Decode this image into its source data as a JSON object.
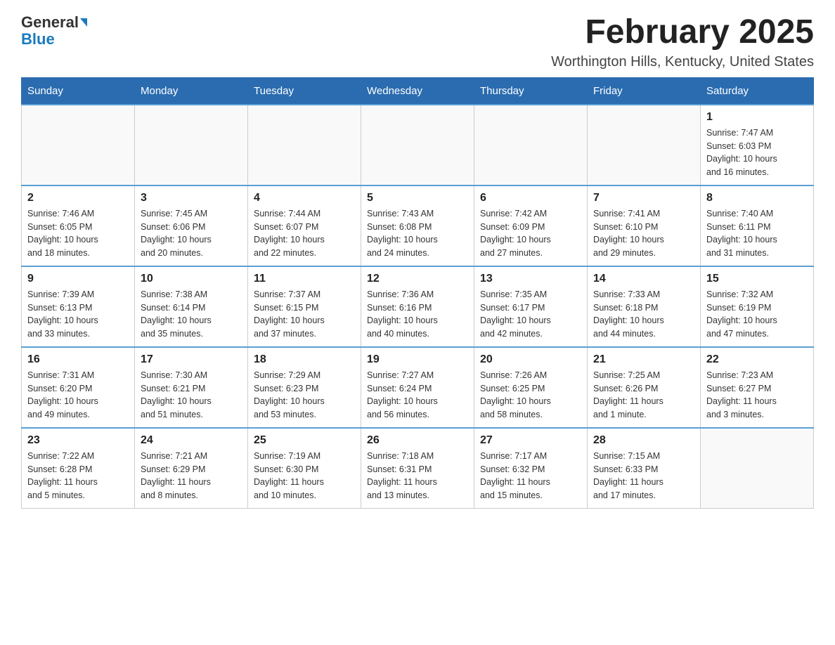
{
  "header": {
    "logo_general": "General",
    "logo_blue": "Blue",
    "month_title": "February 2025",
    "location": "Worthington Hills, Kentucky, United States"
  },
  "days_of_week": [
    "Sunday",
    "Monday",
    "Tuesday",
    "Wednesday",
    "Thursday",
    "Friday",
    "Saturday"
  ],
  "weeks": [
    [
      {
        "day": "",
        "info": ""
      },
      {
        "day": "",
        "info": ""
      },
      {
        "day": "",
        "info": ""
      },
      {
        "day": "",
        "info": ""
      },
      {
        "day": "",
        "info": ""
      },
      {
        "day": "",
        "info": ""
      },
      {
        "day": "1",
        "info": "Sunrise: 7:47 AM\nSunset: 6:03 PM\nDaylight: 10 hours\nand 16 minutes."
      }
    ],
    [
      {
        "day": "2",
        "info": "Sunrise: 7:46 AM\nSunset: 6:05 PM\nDaylight: 10 hours\nand 18 minutes."
      },
      {
        "day": "3",
        "info": "Sunrise: 7:45 AM\nSunset: 6:06 PM\nDaylight: 10 hours\nand 20 minutes."
      },
      {
        "day": "4",
        "info": "Sunrise: 7:44 AM\nSunset: 6:07 PM\nDaylight: 10 hours\nand 22 minutes."
      },
      {
        "day": "5",
        "info": "Sunrise: 7:43 AM\nSunset: 6:08 PM\nDaylight: 10 hours\nand 24 minutes."
      },
      {
        "day": "6",
        "info": "Sunrise: 7:42 AM\nSunset: 6:09 PM\nDaylight: 10 hours\nand 27 minutes."
      },
      {
        "day": "7",
        "info": "Sunrise: 7:41 AM\nSunset: 6:10 PM\nDaylight: 10 hours\nand 29 minutes."
      },
      {
        "day": "8",
        "info": "Sunrise: 7:40 AM\nSunset: 6:11 PM\nDaylight: 10 hours\nand 31 minutes."
      }
    ],
    [
      {
        "day": "9",
        "info": "Sunrise: 7:39 AM\nSunset: 6:13 PM\nDaylight: 10 hours\nand 33 minutes."
      },
      {
        "day": "10",
        "info": "Sunrise: 7:38 AM\nSunset: 6:14 PM\nDaylight: 10 hours\nand 35 minutes."
      },
      {
        "day": "11",
        "info": "Sunrise: 7:37 AM\nSunset: 6:15 PM\nDaylight: 10 hours\nand 37 minutes."
      },
      {
        "day": "12",
        "info": "Sunrise: 7:36 AM\nSunset: 6:16 PM\nDaylight: 10 hours\nand 40 minutes."
      },
      {
        "day": "13",
        "info": "Sunrise: 7:35 AM\nSunset: 6:17 PM\nDaylight: 10 hours\nand 42 minutes."
      },
      {
        "day": "14",
        "info": "Sunrise: 7:33 AM\nSunset: 6:18 PM\nDaylight: 10 hours\nand 44 minutes."
      },
      {
        "day": "15",
        "info": "Sunrise: 7:32 AM\nSunset: 6:19 PM\nDaylight: 10 hours\nand 47 minutes."
      }
    ],
    [
      {
        "day": "16",
        "info": "Sunrise: 7:31 AM\nSunset: 6:20 PM\nDaylight: 10 hours\nand 49 minutes."
      },
      {
        "day": "17",
        "info": "Sunrise: 7:30 AM\nSunset: 6:21 PM\nDaylight: 10 hours\nand 51 minutes."
      },
      {
        "day": "18",
        "info": "Sunrise: 7:29 AM\nSunset: 6:23 PM\nDaylight: 10 hours\nand 53 minutes."
      },
      {
        "day": "19",
        "info": "Sunrise: 7:27 AM\nSunset: 6:24 PM\nDaylight: 10 hours\nand 56 minutes."
      },
      {
        "day": "20",
        "info": "Sunrise: 7:26 AM\nSunset: 6:25 PM\nDaylight: 10 hours\nand 58 minutes."
      },
      {
        "day": "21",
        "info": "Sunrise: 7:25 AM\nSunset: 6:26 PM\nDaylight: 11 hours\nand 1 minute."
      },
      {
        "day": "22",
        "info": "Sunrise: 7:23 AM\nSunset: 6:27 PM\nDaylight: 11 hours\nand 3 minutes."
      }
    ],
    [
      {
        "day": "23",
        "info": "Sunrise: 7:22 AM\nSunset: 6:28 PM\nDaylight: 11 hours\nand 5 minutes."
      },
      {
        "day": "24",
        "info": "Sunrise: 7:21 AM\nSunset: 6:29 PM\nDaylight: 11 hours\nand 8 minutes."
      },
      {
        "day": "25",
        "info": "Sunrise: 7:19 AM\nSunset: 6:30 PM\nDaylight: 11 hours\nand 10 minutes."
      },
      {
        "day": "26",
        "info": "Sunrise: 7:18 AM\nSunset: 6:31 PM\nDaylight: 11 hours\nand 13 minutes."
      },
      {
        "day": "27",
        "info": "Sunrise: 7:17 AM\nSunset: 6:32 PM\nDaylight: 11 hours\nand 15 minutes."
      },
      {
        "day": "28",
        "info": "Sunrise: 7:15 AM\nSunset: 6:33 PM\nDaylight: 11 hours\nand 17 minutes."
      },
      {
        "day": "",
        "info": ""
      }
    ]
  ]
}
